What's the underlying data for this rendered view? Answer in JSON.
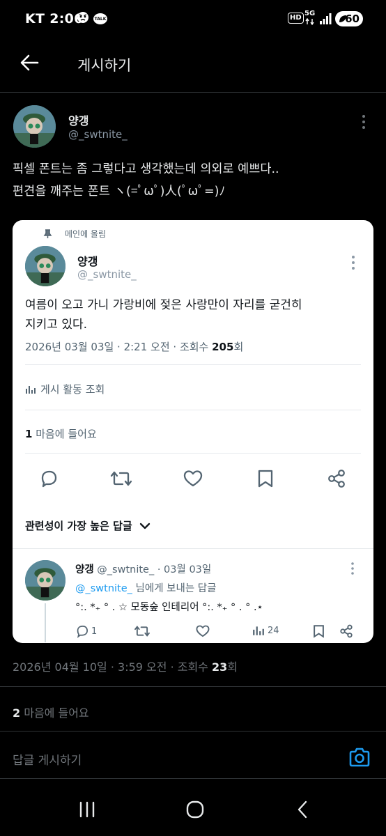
{
  "status_bar": {
    "carrier_time": "KT 2:06",
    "talk_badge": "TALK",
    "hd": "HD",
    "network": "5G",
    "battery": "60"
  },
  "header": {
    "title": "게시하기",
    "back_icon": "arrow-left-icon"
  },
  "post": {
    "author_name": "양갱",
    "author_handle": "@_swtnite_",
    "text": "픽셀 폰트는 좀 그렇다고 생각했는데 의외로 예쁘다..\n편견을 깨주는 폰트 ヽ(=ﾟωﾟ)人(ﾟωﾟ=)ﾉ",
    "timestamp": "2026년 04월 10일 · 3:59 오전 · 조회수 ",
    "views": "23",
    "views_suffix": "회",
    "likes_count": "2",
    "likes_label": " 마음에 들어요"
  },
  "quoted": {
    "pin_label": "메인에 올림",
    "author_name": "양갱",
    "author_handle": "@_swtnite_",
    "text": "여름이 오고 가니 가랑비에 젖은 사랑만이 자리를 굳건히\n지키고 있다.",
    "timestamp": "2026년 03월 03일 · 2:21 오전 · 조회수 ",
    "views": "205",
    "views_suffix": "회",
    "activity_label": "게시 활동 조회",
    "likes_count": "1",
    "likes_label": " 마음에 들어요",
    "sort_label": "관련성이 가장 높은 답글",
    "actions": [
      "reply-icon",
      "retweet-icon",
      "heart-icon",
      "bookmark-icon",
      "share-icon"
    ]
  },
  "reply": {
    "author_name": "양갱",
    "author_handle": "@_swtnite_",
    "date": " · 03월 03일",
    "mention": "@_swtnite_",
    "mention_suffix": " 님에게 보내는 답글",
    "text": "°:. *₊ ° . ☆ 모동숲 인테리어 °:. *₊ ° . ° .⋆",
    "reply_count": "1",
    "view_count": "24"
  },
  "composer": {
    "placeholder": "답글 게시하기",
    "camera_icon": "camera-icon"
  },
  "colors": {
    "accent": "#1d9bf0",
    "background": "#000000",
    "card": "#ffffff"
  }
}
